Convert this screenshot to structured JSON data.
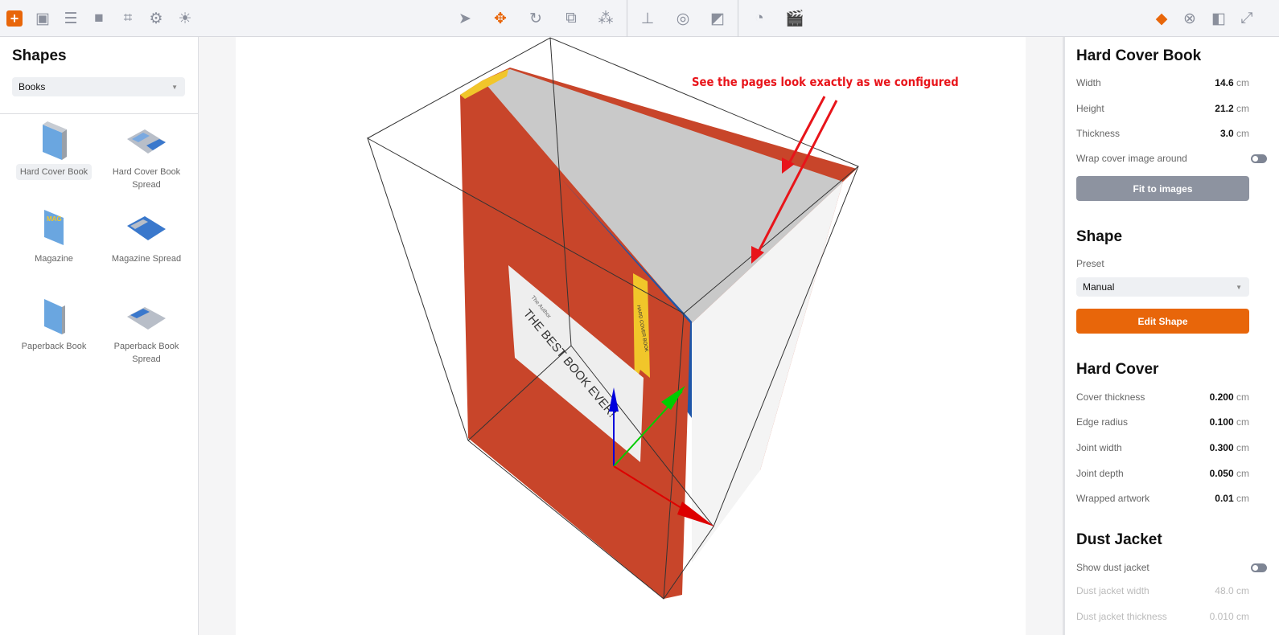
{
  "colors": {
    "accent": "#e8660a",
    "toolbar_bg": "#f3f4f7",
    "annotation": "#e8141a",
    "book_cover": "#c8452a",
    "book_inner": "#1f56a8",
    "ribbon": "#f1c62a"
  },
  "toolbar": {
    "left": [
      {
        "icon": "add-icon"
      },
      {
        "icon": "grid-icon"
      },
      {
        "icon": "list-icon"
      },
      {
        "icon": "camera-icon"
      },
      {
        "icon": "focus-icon"
      },
      {
        "icon": "gear-icon"
      },
      {
        "icon": "light-icon"
      }
    ],
    "center": [
      {
        "icon": "select-arrow-icon"
      },
      {
        "icon": "move-icon",
        "active": true
      },
      {
        "icon": "rotate-icon"
      },
      {
        "icon": "scale-icon"
      },
      {
        "icon": "pivot-icon"
      },
      {
        "icon": "floor-icon"
      },
      {
        "icon": "zoom-object-icon"
      },
      {
        "icon": "material-icon"
      },
      {
        "icon": "time-icon"
      },
      {
        "icon": "clapper-icon"
      }
    ],
    "right": [
      {
        "icon": "cube-icon",
        "active": true
      },
      {
        "icon": "texture-icon"
      },
      {
        "icon": "panel-icon"
      },
      {
        "icon": "fullscreen-icon"
      }
    ]
  },
  "left_panel": {
    "title": "Shapes",
    "category": "Books",
    "shapes": [
      {
        "label": "Hard Cover Book",
        "selected": true
      },
      {
        "label": "Hard Cover Book Spread"
      },
      {
        "label": "Magazine",
        "cover_text": "MAG"
      },
      {
        "label": "Magazine Spread"
      },
      {
        "label": "Paperback Book"
      },
      {
        "label": "Paperback Book Spread"
      }
    ]
  },
  "viewport": {
    "annotation": "See the pages look exactly as we configured",
    "cover_title": "THE BEST BOOK EVER!",
    "cover_author": "The Author",
    "ribbon_text": "HARD COVER BOOK"
  },
  "right_panel": {
    "book": {
      "title": "Hard Cover Book",
      "width": {
        "label": "Width",
        "value": "14.6",
        "unit": "cm"
      },
      "height": {
        "label": "Height",
        "value": "21.2",
        "unit": "cm"
      },
      "thickness": {
        "label": "Thickness",
        "value": "3.0",
        "unit": "cm"
      },
      "wrap": {
        "label": "Wrap cover image around",
        "on": false
      },
      "fit_button": "Fit to images"
    },
    "shape": {
      "title": "Shape",
      "preset_label": "Preset",
      "preset": "Manual",
      "edit_button": "Edit Shape"
    },
    "hard_cover": {
      "title": "Hard Cover",
      "rows": [
        {
          "label": "Cover thickness",
          "value": "0.200",
          "unit": "cm"
        },
        {
          "label": "Edge radius",
          "value": "0.100",
          "unit": "cm"
        },
        {
          "label": "Joint width",
          "value": "0.300",
          "unit": "cm"
        },
        {
          "label": "Joint depth",
          "value": "0.050",
          "unit": "cm"
        },
        {
          "label": "Wrapped artwork",
          "value": "0.01",
          "unit": "cm"
        }
      ]
    },
    "dust_jacket": {
      "title": "Dust Jacket",
      "show": {
        "label": "Show dust jacket",
        "on": false
      },
      "rows": [
        {
          "label": "Dust jacket width",
          "value": "48.0",
          "unit": "cm"
        },
        {
          "label": "Dust jacket thickness",
          "value": "0.010",
          "unit": "cm"
        }
      ]
    }
  }
}
